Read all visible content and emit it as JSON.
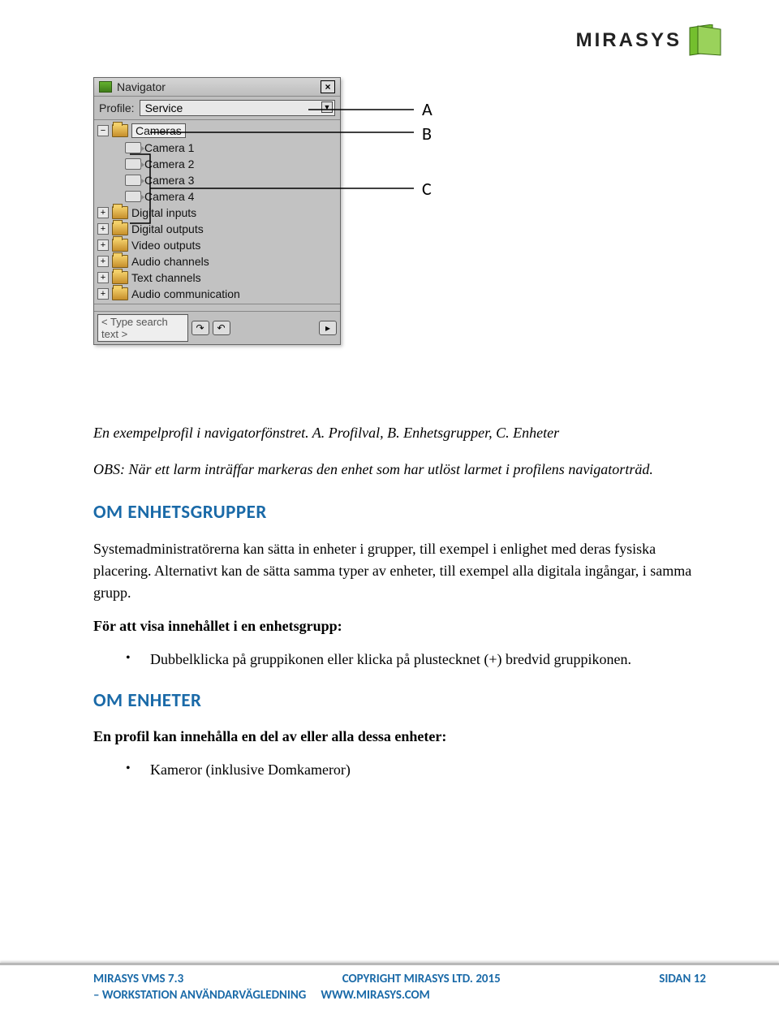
{
  "brand": {
    "name": "MIRASYS"
  },
  "callouts": {
    "a": "A",
    "b": "B",
    "c": "C"
  },
  "navigator": {
    "title": "Navigator",
    "close": "×",
    "profile_label": "Profile:",
    "profile_value": "Service",
    "groups": [
      {
        "label": "Cameras",
        "expanded": true,
        "selected": true,
        "children": [
          "Camera 1",
          "Camera 2",
          "Camera 3",
          "Camera 4"
        ]
      },
      {
        "label": "Digital inputs",
        "expanded": false
      },
      {
        "label": "Digital outputs",
        "expanded": false
      },
      {
        "label": "Video outputs",
        "expanded": false
      },
      {
        "label": "Audio channels",
        "expanded": false
      },
      {
        "label": "Text channels",
        "expanded": false
      },
      {
        "label": "Audio communication",
        "expanded": false
      }
    ],
    "search_placeholder": "< Type search text >"
  },
  "text": {
    "caption": "En exempelprofil i navigatorfönstret. A. Profilval, B. Enhetsgrupper, C. Enheter",
    "obs": "OBS: När ett larm inträffar markeras den enhet som har utlöst larmet i profilens navigatorträd.",
    "h_groups": "OM ENHETSGRUPPER",
    "p_groups": "Systemadministratörerna kan sätta in enheter i grupper, till exempel i enlighet med deras fysiska placering. Alternativt kan de sätta samma typer av enheter, till exempel alla digitala ingångar, i samma grupp.",
    "p_show_label": "För att visa innehållet i en enhetsgrupp:",
    "p_show_item": "Dubbelklicka på gruppikonen eller klicka på plustecknet (+) bredvid gruppikonen.",
    "h_units": "OM ENHETER",
    "p_units_lead": "En profil kan innehålla en del av eller alla dessa enheter:",
    "p_units_item": "Kameror (inklusive Domkameror)"
  },
  "footer": {
    "left": "MIRASYS VMS 7.3",
    "center": "COPYRIGHT MIRASYS LTD. 2015",
    "right": "SIDAN 12",
    "sub_left": "– WORKSTATION ANVÄNDARVÄGLEDNING",
    "sub_right": "WWW.MIRASYS.COM"
  }
}
